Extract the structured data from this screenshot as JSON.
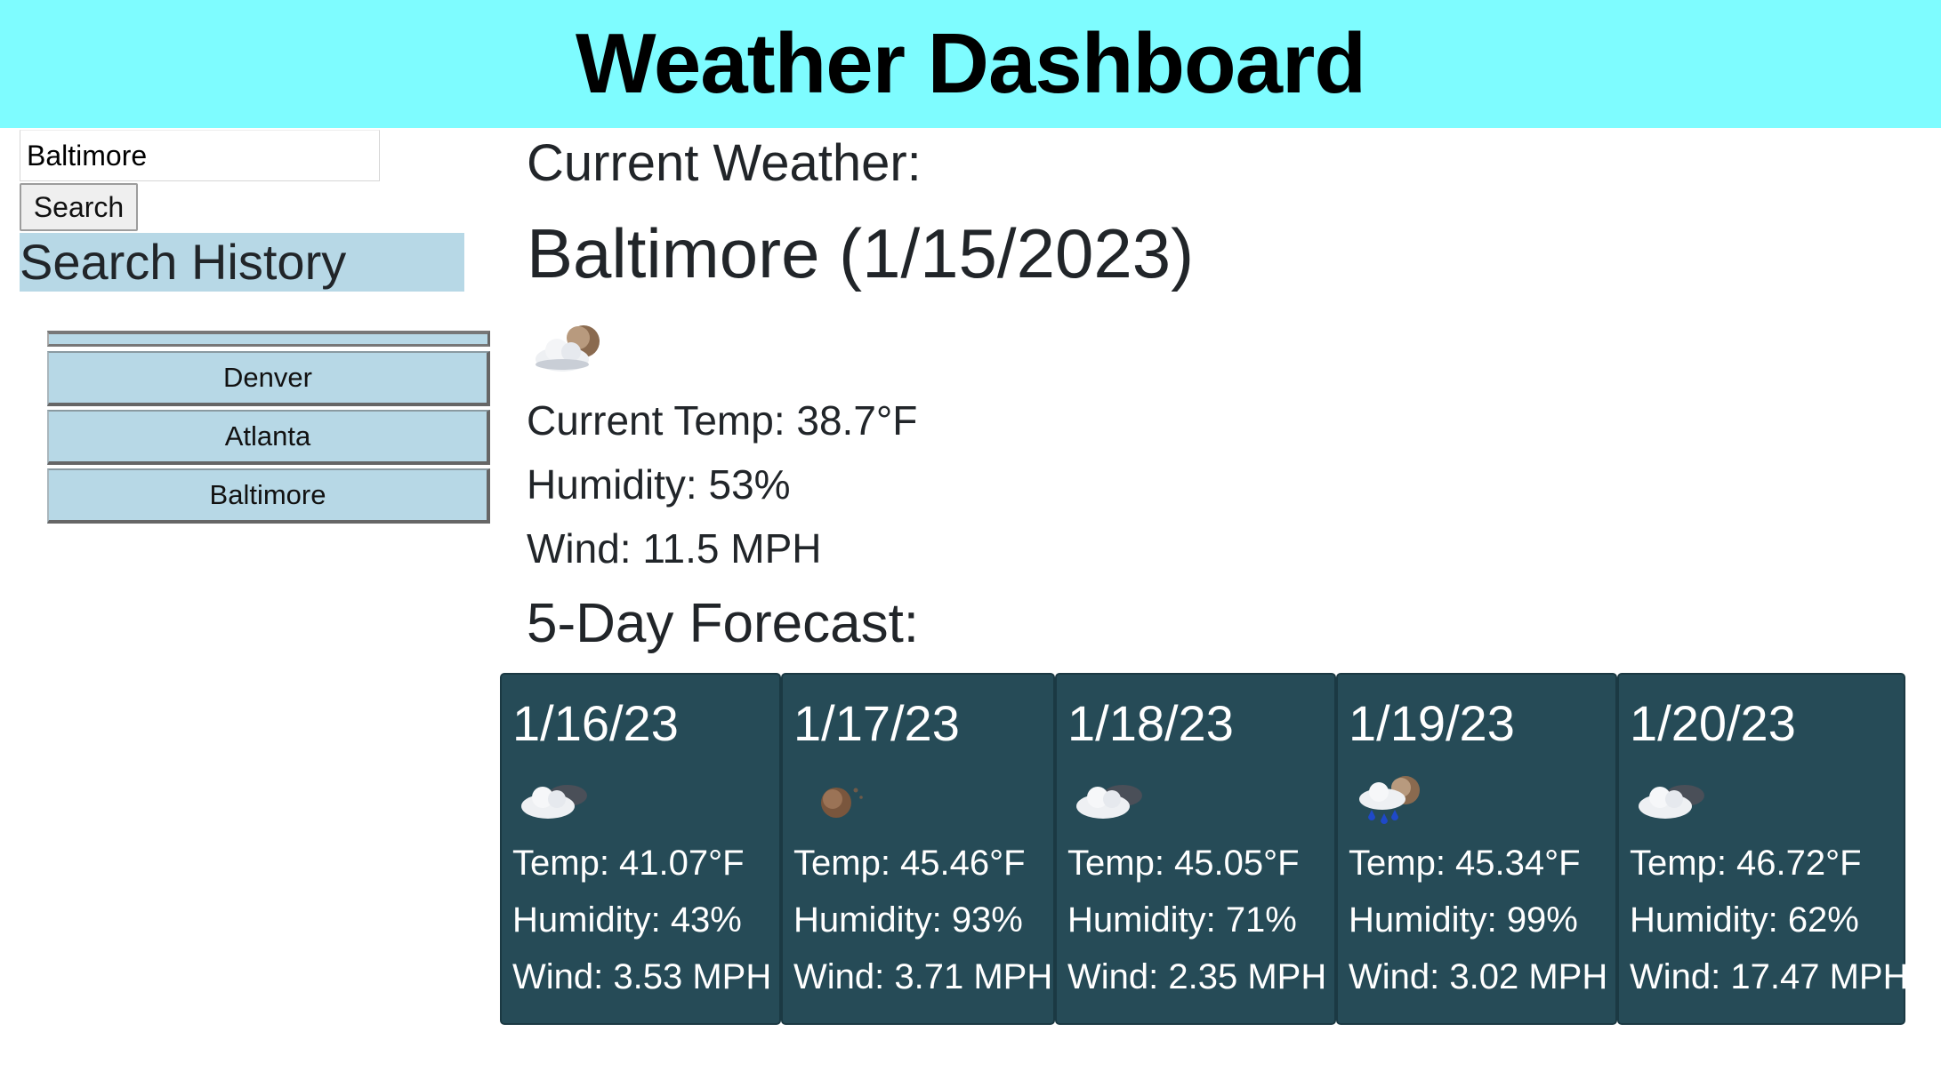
{
  "header": {
    "title": "Weather Dashboard"
  },
  "search": {
    "value": "Baltimore",
    "button_label": "Search"
  },
  "history": {
    "title": "Search History",
    "items": [
      "Denver",
      "Atlanta",
      "Baltimore"
    ]
  },
  "current": {
    "label": "Current Weather:",
    "city_date": "Baltimore (1/15/2023)",
    "icon": "partly-cloudy-night-icon",
    "temp": "Current Temp: 38.7°F",
    "humidity": "Humidity: 53%",
    "wind": "Wind: 11.5 MPH"
  },
  "forecast": {
    "title": "5-Day Forecast:",
    "days": [
      {
        "date": "1/16/23",
        "icon": "cloudy-icon",
        "temp": "Temp: 41.07°F",
        "humidity": "Humidity: 43%",
        "wind": "Wind: 3.53 MPH"
      },
      {
        "date": "1/17/23",
        "icon": "clear-night-icon",
        "temp": "Temp: 45.46°F",
        "humidity": "Humidity: 93%",
        "wind": "Wind: 3.71 MPH"
      },
      {
        "date": "1/18/23",
        "icon": "cloudy-icon",
        "temp": "Temp: 45.05°F",
        "humidity": "Humidity: 71%",
        "wind": "Wind: 2.35 MPH"
      },
      {
        "date": "1/19/23",
        "icon": "rain-night-icon",
        "temp": "Temp: 45.34°F",
        "humidity": "Humidity: 99%",
        "wind": "Wind: 3.02 MPH"
      },
      {
        "date": "1/20/23",
        "icon": "cloudy-icon",
        "temp": "Temp: 46.72°F",
        "humidity": "Humidity: 62%",
        "wind": "Wind: 17.47 MPH"
      }
    ]
  }
}
